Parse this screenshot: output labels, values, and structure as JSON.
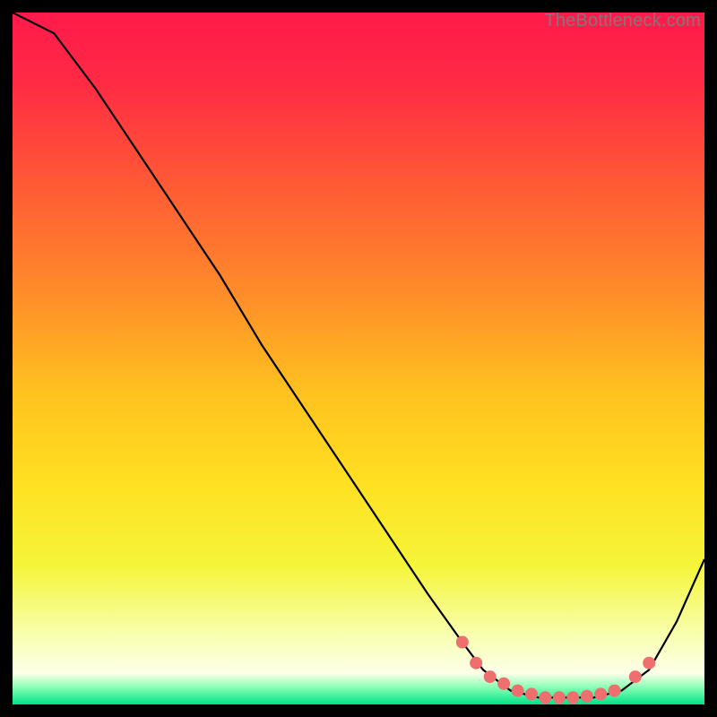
{
  "watermark": "TheBottleneck.com",
  "chart_data": {
    "type": "line",
    "title": "",
    "xlabel": "",
    "ylabel": "",
    "xlim": [
      0,
      100
    ],
    "ylim": [
      0,
      100
    ],
    "curve": {
      "x": [
        0,
        6,
        12,
        18,
        24,
        30,
        36,
        42,
        48,
        54,
        60,
        65,
        68,
        72,
        76,
        80,
        84,
        88,
        92,
        96,
        100
      ],
      "y": [
        100,
        97,
        89,
        80,
        71,
        62,
        52,
        43,
        34,
        25,
        16,
        9,
        5,
        2,
        1,
        1,
        1,
        2,
        5,
        12,
        21
      ]
    },
    "markers": {
      "x": [
        65,
        67,
        69,
        71,
        73,
        75,
        77,
        79,
        81,
        83,
        85,
        87,
        90,
        92
      ],
      "y": [
        9,
        6,
        4,
        3,
        2,
        1.5,
        1,
        1,
        1,
        1.2,
        1.5,
        2,
        4,
        6
      ]
    },
    "marker_color": "#ef6e6e",
    "marker_radius_px": 7,
    "gradient_stops": [
      {
        "offset": 0.0,
        "color": "#ff1a4b"
      },
      {
        "offset": 0.1,
        "color": "#ff2a44"
      },
      {
        "offset": 0.25,
        "color": "#ff5a35"
      },
      {
        "offset": 0.4,
        "color": "#ff8a2a"
      },
      {
        "offset": 0.55,
        "color": "#ffc21f"
      },
      {
        "offset": 0.68,
        "color": "#ffe022"
      },
      {
        "offset": 0.8,
        "color": "#f5f53a"
      },
      {
        "offset": 0.9,
        "color": "#f8ffb0"
      },
      {
        "offset": 0.955,
        "color": "#fdffe8"
      },
      {
        "offset": 0.975,
        "color": "#8affb4"
      },
      {
        "offset": 1.0,
        "color": "#00e28a"
      }
    ]
  }
}
